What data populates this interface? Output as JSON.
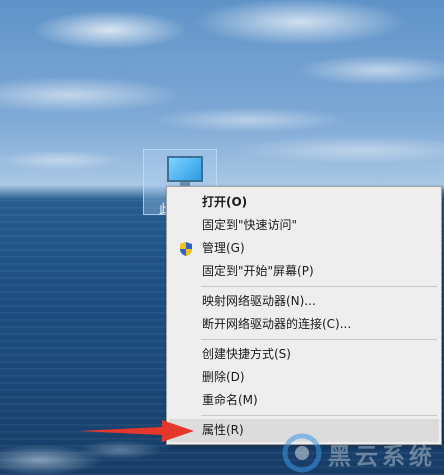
{
  "desktop_icon": {
    "label_fragment": "此"
  },
  "context_menu": {
    "items": [
      {
        "label": "打开(O)",
        "bold": true
      },
      {
        "label": "固定到\"快速访问\""
      },
      {
        "label": "管理(G)",
        "icon": "shield-icon"
      },
      {
        "label": "固定到\"开始\"屏幕(P)"
      },
      {
        "label": "映射网络驱动器(N)..."
      },
      {
        "label": "断开网络驱动器的连接(C)..."
      },
      {
        "label": "创建快捷方式(S)"
      },
      {
        "label": "删除(D)"
      },
      {
        "label": "重命名(M)"
      },
      {
        "label": "属性(R)",
        "highlighted": true
      }
    ]
  },
  "watermark": {
    "text": "黑云系统"
  },
  "colors": {
    "menu_bg": "#eeeeee",
    "menu_hover": "#dcdcdc",
    "arrow": "#e5372b",
    "shield_blue": "#2b63c6",
    "shield_yellow": "#f2c218"
  }
}
